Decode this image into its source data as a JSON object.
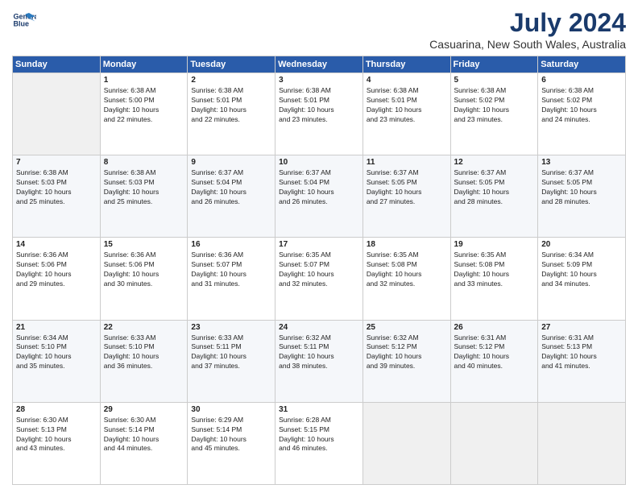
{
  "logo": {
    "line1": "General",
    "line2": "Blue"
  },
  "title": "July 2024",
  "subtitle": "Casuarina, New South Wales, Australia",
  "days_header": [
    "Sunday",
    "Monday",
    "Tuesday",
    "Wednesday",
    "Thursday",
    "Friday",
    "Saturday"
  ],
  "weeks": [
    [
      {
        "day": "",
        "info": ""
      },
      {
        "day": "1",
        "info": "Sunrise: 6:38 AM\nSunset: 5:00 PM\nDaylight: 10 hours\nand 22 minutes."
      },
      {
        "day": "2",
        "info": "Sunrise: 6:38 AM\nSunset: 5:01 PM\nDaylight: 10 hours\nand 22 minutes."
      },
      {
        "day": "3",
        "info": "Sunrise: 6:38 AM\nSunset: 5:01 PM\nDaylight: 10 hours\nand 23 minutes."
      },
      {
        "day": "4",
        "info": "Sunrise: 6:38 AM\nSunset: 5:01 PM\nDaylight: 10 hours\nand 23 minutes."
      },
      {
        "day": "5",
        "info": "Sunrise: 6:38 AM\nSunset: 5:02 PM\nDaylight: 10 hours\nand 23 minutes."
      },
      {
        "day": "6",
        "info": "Sunrise: 6:38 AM\nSunset: 5:02 PM\nDaylight: 10 hours\nand 24 minutes."
      }
    ],
    [
      {
        "day": "7",
        "info": "Sunrise: 6:38 AM\nSunset: 5:03 PM\nDaylight: 10 hours\nand 25 minutes."
      },
      {
        "day": "8",
        "info": "Sunrise: 6:38 AM\nSunset: 5:03 PM\nDaylight: 10 hours\nand 25 minutes."
      },
      {
        "day": "9",
        "info": "Sunrise: 6:37 AM\nSunset: 5:04 PM\nDaylight: 10 hours\nand 26 minutes."
      },
      {
        "day": "10",
        "info": "Sunrise: 6:37 AM\nSunset: 5:04 PM\nDaylight: 10 hours\nand 26 minutes."
      },
      {
        "day": "11",
        "info": "Sunrise: 6:37 AM\nSunset: 5:05 PM\nDaylight: 10 hours\nand 27 minutes."
      },
      {
        "day": "12",
        "info": "Sunrise: 6:37 AM\nSunset: 5:05 PM\nDaylight: 10 hours\nand 28 minutes."
      },
      {
        "day": "13",
        "info": "Sunrise: 6:37 AM\nSunset: 5:05 PM\nDaylight: 10 hours\nand 28 minutes."
      }
    ],
    [
      {
        "day": "14",
        "info": "Sunrise: 6:36 AM\nSunset: 5:06 PM\nDaylight: 10 hours\nand 29 minutes."
      },
      {
        "day": "15",
        "info": "Sunrise: 6:36 AM\nSunset: 5:06 PM\nDaylight: 10 hours\nand 30 minutes."
      },
      {
        "day": "16",
        "info": "Sunrise: 6:36 AM\nSunset: 5:07 PM\nDaylight: 10 hours\nand 31 minutes."
      },
      {
        "day": "17",
        "info": "Sunrise: 6:35 AM\nSunset: 5:07 PM\nDaylight: 10 hours\nand 32 minutes."
      },
      {
        "day": "18",
        "info": "Sunrise: 6:35 AM\nSunset: 5:08 PM\nDaylight: 10 hours\nand 32 minutes."
      },
      {
        "day": "19",
        "info": "Sunrise: 6:35 AM\nSunset: 5:08 PM\nDaylight: 10 hours\nand 33 minutes."
      },
      {
        "day": "20",
        "info": "Sunrise: 6:34 AM\nSunset: 5:09 PM\nDaylight: 10 hours\nand 34 minutes."
      }
    ],
    [
      {
        "day": "21",
        "info": "Sunrise: 6:34 AM\nSunset: 5:10 PM\nDaylight: 10 hours\nand 35 minutes."
      },
      {
        "day": "22",
        "info": "Sunrise: 6:33 AM\nSunset: 5:10 PM\nDaylight: 10 hours\nand 36 minutes."
      },
      {
        "day": "23",
        "info": "Sunrise: 6:33 AM\nSunset: 5:11 PM\nDaylight: 10 hours\nand 37 minutes."
      },
      {
        "day": "24",
        "info": "Sunrise: 6:32 AM\nSunset: 5:11 PM\nDaylight: 10 hours\nand 38 minutes."
      },
      {
        "day": "25",
        "info": "Sunrise: 6:32 AM\nSunset: 5:12 PM\nDaylight: 10 hours\nand 39 minutes."
      },
      {
        "day": "26",
        "info": "Sunrise: 6:31 AM\nSunset: 5:12 PM\nDaylight: 10 hours\nand 40 minutes."
      },
      {
        "day": "27",
        "info": "Sunrise: 6:31 AM\nSunset: 5:13 PM\nDaylight: 10 hours\nand 41 minutes."
      }
    ],
    [
      {
        "day": "28",
        "info": "Sunrise: 6:30 AM\nSunset: 5:13 PM\nDaylight: 10 hours\nand 43 minutes."
      },
      {
        "day": "29",
        "info": "Sunrise: 6:30 AM\nSunset: 5:14 PM\nDaylight: 10 hours\nand 44 minutes."
      },
      {
        "day": "30",
        "info": "Sunrise: 6:29 AM\nSunset: 5:14 PM\nDaylight: 10 hours\nand 45 minutes."
      },
      {
        "day": "31",
        "info": "Sunrise: 6:28 AM\nSunset: 5:15 PM\nDaylight: 10 hours\nand 46 minutes."
      },
      {
        "day": "",
        "info": ""
      },
      {
        "day": "",
        "info": ""
      },
      {
        "day": "",
        "info": ""
      }
    ]
  ]
}
